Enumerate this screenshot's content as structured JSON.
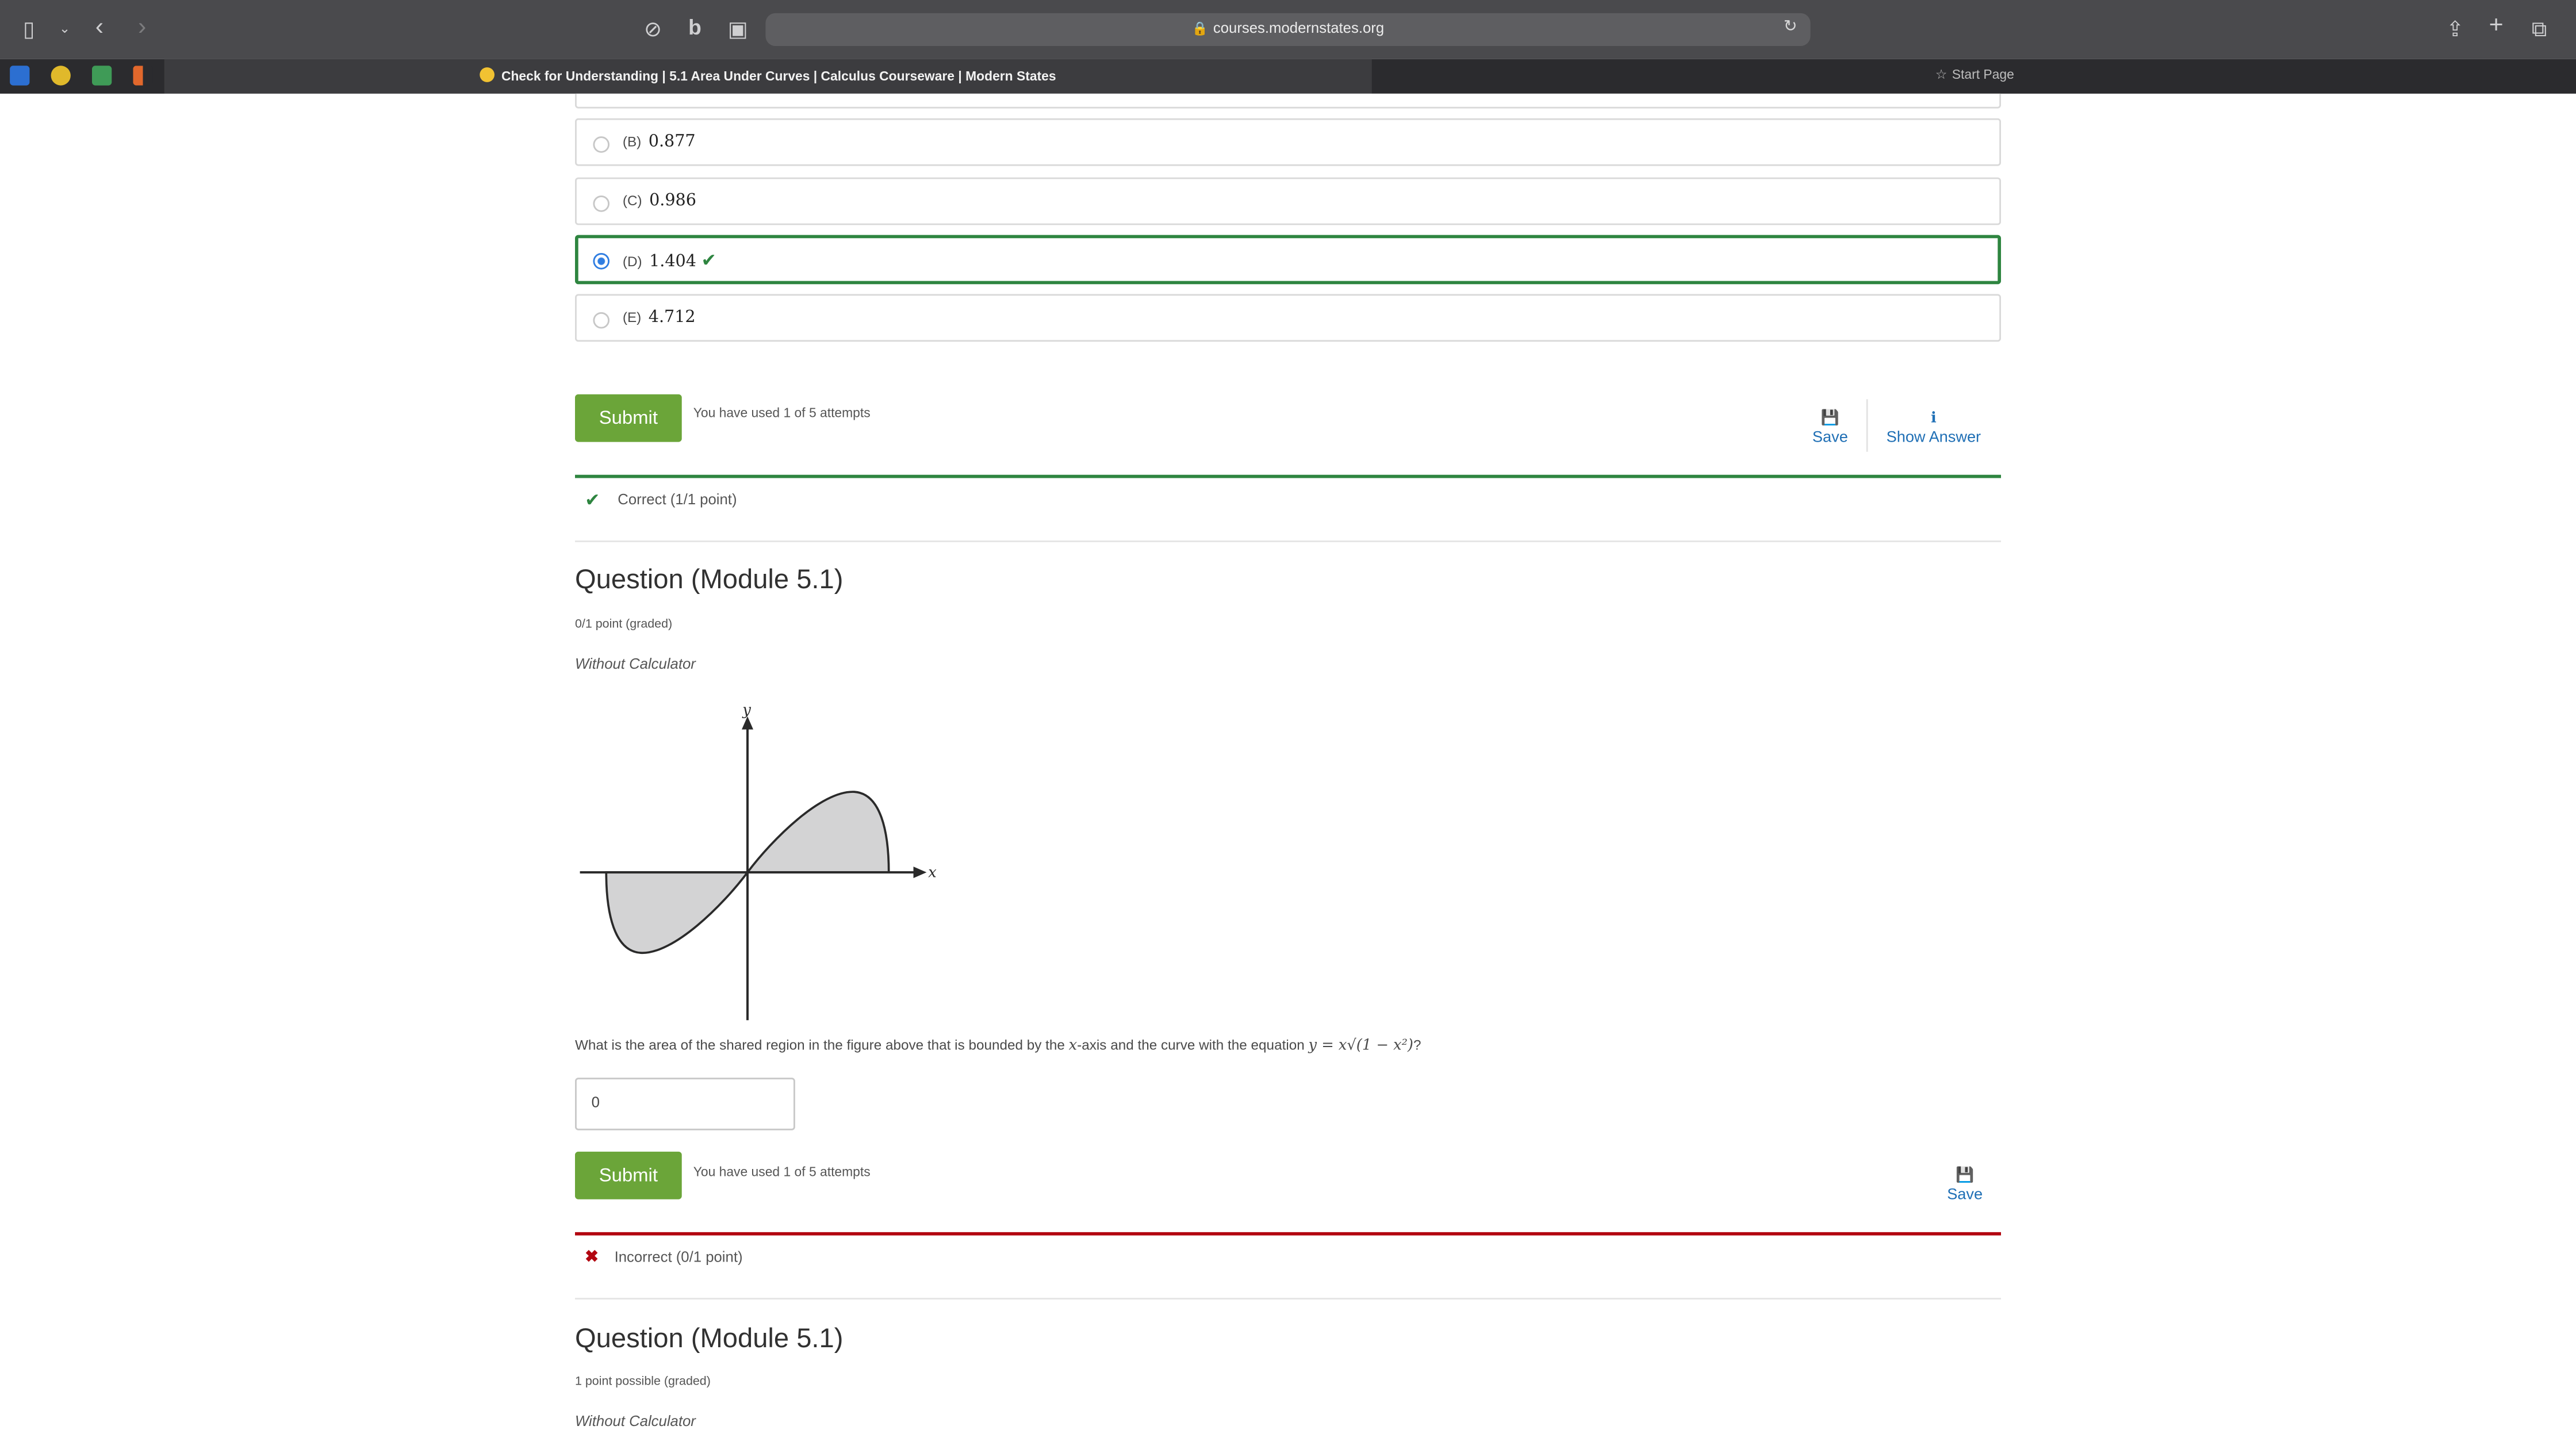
{
  "browser": {
    "url": "courses.modernstates.org",
    "active_tab": "Check for Understanding | 5.1 Area Under Curves | Calculus Courseware | Modern States",
    "second_tab": "Start Page"
  },
  "q1": {
    "choices": [
      {
        "letter": "(B)",
        "value": "0.877"
      },
      {
        "letter": "(C)",
        "value": "0.986"
      },
      {
        "letter": "(D)",
        "value": "1.404"
      },
      {
        "letter": "(E)",
        "value": "4.712"
      }
    ],
    "selected_choice": "(D)",
    "submit_label": "Submit",
    "attempts": "You have used 1 of 5 attempts",
    "save_label": "Save",
    "show_answer_label": "Show Answer",
    "result": "Correct (1/1 point)"
  },
  "q2": {
    "title": "Question (Module 5.1)",
    "points": "0/1 point (graded)",
    "calc": "Without Calculator",
    "graph": {
      "y_label": "y",
      "x_label": "x"
    },
    "question_prefix": "What is the area of the shared region in the figure above that is bounded by the ",
    "x_var": "x",
    "question_middle": "-axis and the curve with the equation ",
    "equation": "y = x√(1 − x²)",
    "question_suffix": "?",
    "answer_value": "0",
    "submit_label": "Submit",
    "attempts": "You have used 1 of 5 attempts",
    "save_label": "Save",
    "result": "Incorrect (0/1 point)"
  },
  "q3": {
    "title": "Question (Module 5.1)",
    "points": "1 point possible (graded)",
    "calc": "Without Calculator"
  },
  "colors": {
    "submit_green": "#6ba539",
    "correct_green": "#2e8540",
    "incorrect_red": "#b20610",
    "link_blue": "#1f6fb5"
  }
}
